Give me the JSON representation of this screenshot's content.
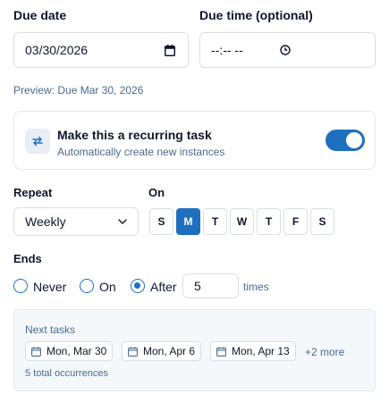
{
  "due_date": {
    "label": "Due date",
    "value": "03/30/2026"
  },
  "due_time": {
    "label": "Due time (optional)",
    "value": "--:-- --"
  },
  "preview": "Preview: Due Mar 30, 2026",
  "recurring": {
    "title": "Make this a recurring task",
    "subtitle": "Automatically create new instances",
    "enabled": true
  },
  "repeat": {
    "label": "Repeat",
    "selected": "Weekly"
  },
  "on": {
    "label": "On",
    "days": [
      "S",
      "M",
      "T",
      "W",
      "T",
      "F",
      "S"
    ],
    "selected_index": 1
  },
  "ends": {
    "label": "Ends",
    "options": [
      "Never",
      "On",
      "After"
    ],
    "selected": "After",
    "after_count": "5",
    "times_label": "times"
  },
  "next_tasks": {
    "title": "Next tasks",
    "dates": [
      "Mon, Mar 30",
      "Mon, Apr 6",
      "Mon, Apr 13"
    ],
    "more": "+2 more",
    "total": "5 total occurrences"
  },
  "colors": {
    "accent": "#1f6fbf",
    "muted_text": "#4b6a8a",
    "border": "#d9dee5"
  }
}
